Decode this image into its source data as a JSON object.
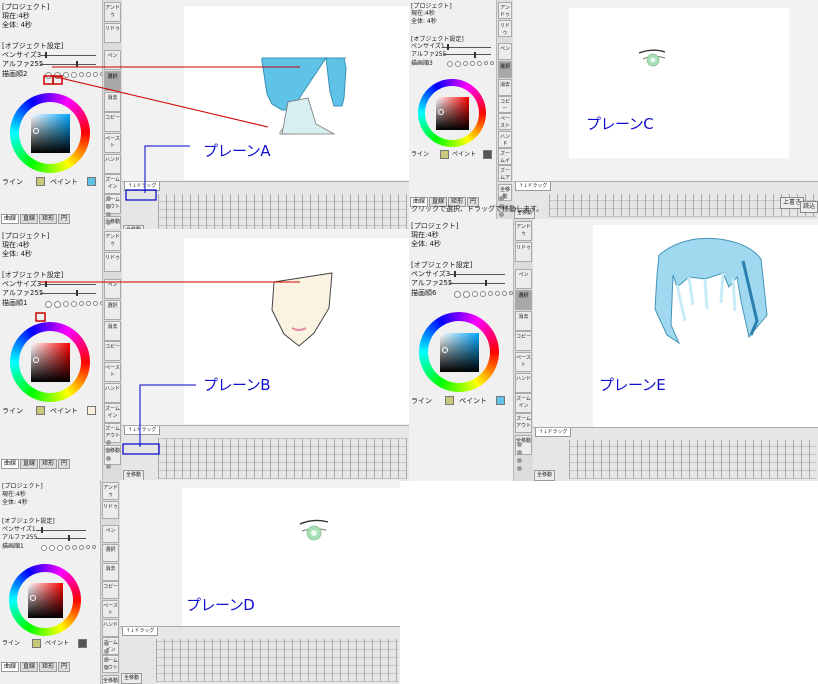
{
  "left_panel": {
    "project_header": "[プロジェクト]",
    "object_header": "[オブジェクト設定]",
    "line_label": "ライン",
    "paint_label": "ペイント"
  },
  "tool_buttons": [
    "アンドゥ",
    "リドゥ",
    "ペン",
    "選択",
    "消去",
    "コピー",
    "ペースト",
    "ハンド",
    "ズームイン",
    "ズームアウト",
    "全移動"
  ],
  "bottom_tabs": [
    "曲線",
    "直線",
    "矩形",
    "円"
  ],
  "timeline": {
    "tab_label": "↑↓ドラッグ"
  },
  "panels": [
    {
      "id": "A",
      "current": "現在:4秒",
      "total": "全体: 4秒",
      "pen_size": "ペンサイズ3",
      "alpha": "アルファ255",
      "order": "描画順2",
      "selected_tool": "選択",
      "label": "プレーンA",
      "paint_color": "#5ec3e6",
      "line_color": "#c8c87a"
    },
    {
      "id": "B",
      "current": "現在:4秒",
      "total": "全体: 4秒",
      "pen_size": "ペンサイズ3",
      "alpha": "アルファ255",
      "order": "描画順1",
      "selected_tool": "",
      "label": "プレーンB",
      "paint_color": "#f8eedc",
      "line_color": "#c8c87a"
    },
    {
      "id": "C",
      "current": "現在:4秒",
      "total": "全体: 4秒",
      "pen_size": "ペンサイズ1",
      "alpha": "アルファ255",
      "order": "描画順3",
      "selected_tool": "選択",
      "label": "プレーンC",
      "paint_color": "#555555",
      "line_color": "#c8c87a",
      "status_hint": "クリックで選択、ドラッグで移動します。",
      "overwrite_button": "上書き",
      "load_button": "読込"
    },
    {
      "id": "D",
      "current": "現在:4秒",
      "total": "全体: 4秒",
      "pen_size": "ペンサイズ1",
      "alpha": "アルファ255",
      "order": "描画順1",
      "selected_tool": "",
      "label": "プレーンD",
      "paint_color": "#555555",
      "line_color": "#c8c87a"
    },
    {
      "id": "E",
      "current": "現在:4秒",
      "total": "全体: 4秒",
      "pen_size": "ペンサイズ3",
      "alpha": "アルファ255",
      "order": "描画順6",
      "selected_tool": "選択",
      "label": "プレーンE",
      "paint_color": "#5ec3e6",
      "line_color": "#c8c87a"
    }
  ]
}
